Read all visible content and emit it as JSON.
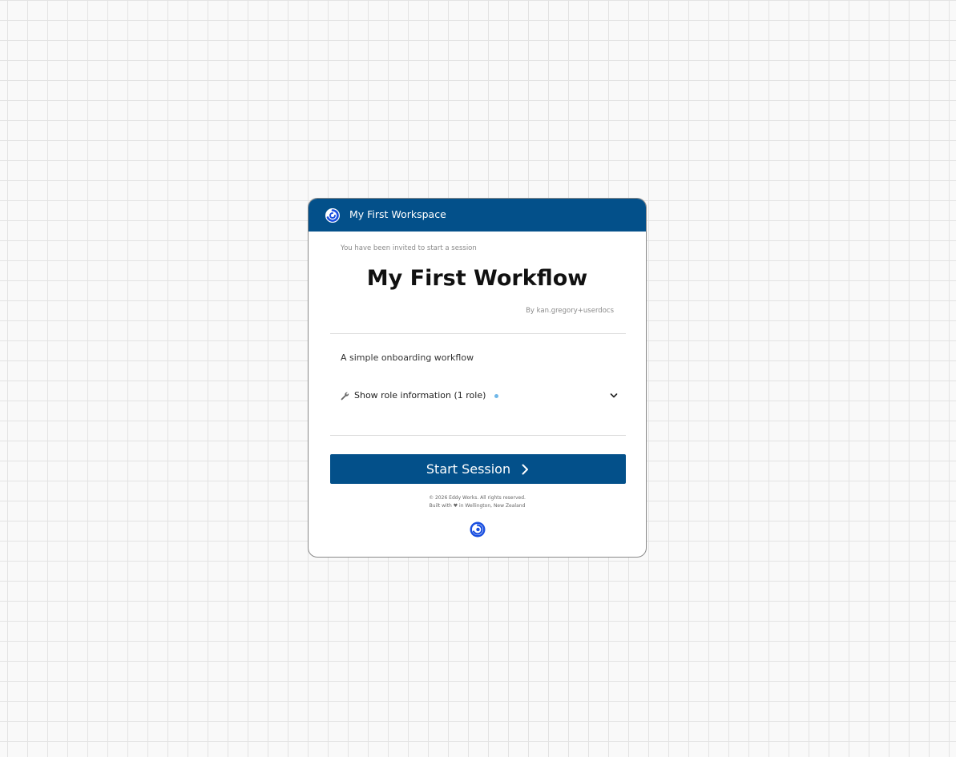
{
  "header": {
    "workspace_name": "My First Workspace",
    "logo_icon": "eddy-logo-icon"
  },
  "session": {
    "invite_text": "You have been invited to start a session",
    "workflow_title": "My First Workflow",
    "author": "By kan.gregory+userdocs",
    "description": "A simple onboarding workflow",
    "role_toggle_label": "Show role information (1 role)",
    "role_dot_color": "#6fb7e8"
  },
  "actions": {
    "start_label": "Start Session"
  },
  "footer": {
    "copyright": "© 2026 Eddy Works. All rights reserved.",
    "built_with": "Built with ♥ in Wellington, New Zealand"
  },
  "colors": {
    "brand": "#03508a",
    "logo_blue": "#1a4fe0"
  }
}
